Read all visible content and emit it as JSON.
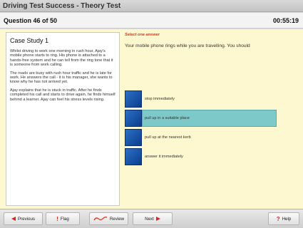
{
  "window": {
    "title": "Driving Test Success - Theory Test"
  },
  "header": {
    "question_counter": "Question 46 of 50",
    "timer": "00:55:19"
  },
  "case_study": {
    "title": "Case Study 1",
    "paragraphs": [
      "Whilst driving to work one morning in rush hour, Ajay's mobile phone starts to ring. His phone is attached to a hands-free system and he can tell from the ring tone that it is someone from work calling.",
      "The roads are busy with rush hour traffic and he is late for work. He answers the call - it is his manager, she wants to know why he has not arrived yet.",
      "Ajay explains that he is stuck in traffic. After he finds completed his call and starts to drive again, he finds himself behind a learner. Ajay can feel his stress levels rising."
    ]
  },
  "question": {
    "instruction": "Select one answer",
    "text": "Your mobile phone rings while you are travelling. You should",
    "answers": [
      {
        "label": "stop immediately",
        "selected": false
      },
      {
        "label": "pull up in a suitable place",
        "selected": true
      },
      {
        "label": "pull up at the nearest kerb",
        "selected": false
      },
      {
        "label": "answer it immediately",
        "selected": false
      }
    ]
  },
  "footer": {
    "previous_label": "Previous",
    "flag_label": "Flag",
    "review_label": "Review",
    "next_label": "Next",
    "help_label": "Help"
  },
  "colors": {
    "selected_highlight": "#7dc8c8",
    "instruction_red": "#e0301e",
    "panel_yellow": "#fdf8cf",
    "answer_box_blue": "#1a56a8"
  }
}
